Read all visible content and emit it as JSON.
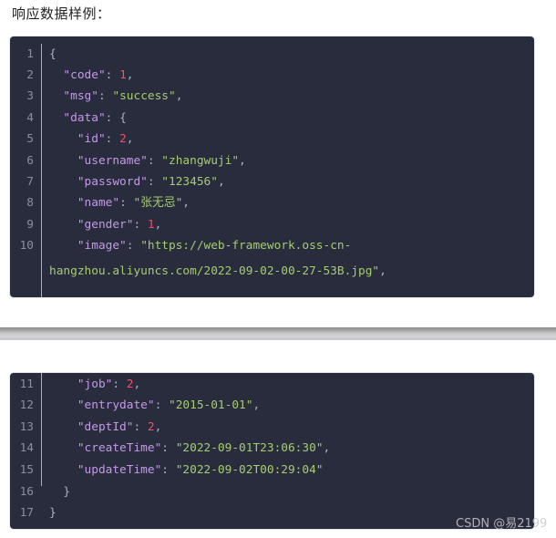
{
  "heading": "响应数据样例：",
  "watermark": "CSDN @易2199",
  "colors": {
    "background": "#282c3c",
    "key": "#c39ae8",
    "string": "#a7cc71",
    "number": "#f0506e",
    "punctuation": "#abb2bf",
    "line_number": "#8a8f9c"
  },
  "blocks": [
    {
      "lines": [
        {
          "num": "1",
          "tokens": [
            {
              "t": "p",
              "v": "{"
            }
          ]
        },
        {
          "num": "2",
          "tokens": [
            {
              "t": "p",
              "v": "  "
            },
            {
              "t": "k",
              "v": "\"code\""
            },
            {
              "t": "p",
              "v": ": "
            },
            {
              "t": "n",
              "v": "1"
            },
            {
              "t": "p",
              "v": ","
            }
          ]
        },
        {
          "num": "3",
          "tokens": [
            {
              "t": "p",
              "v": "  "
            },
            {
              "t": "k",
              "v": "\"msg\""
            },
            {
              "t": "p",
              "v": ": "
            },
            {
              "t": "s",
              "v": "\"success\""
            },
            {
              "t": "p",
              "v": ","
            }
          ]
        },
        {
          "num": "4",
          "tokens": [
            {
              "t": "p",
              "v": "  "
            },
            {
              "t": "k",
              "v": "\"data\""
            },
            {
              "t": "p",
              "v": ": {"
            }
          ]
        },
        {
          "num": "5",
          "tokens": [
            {
              "t": "p",
              "v": "    "
            },
            {
              "t": "k",
              "v": "\"id\""
            },
            {
              "t": "p",
              "v": ": "
            },
            {
              "t": "n",
              "v": "2"
            },
            {
              "t": "p",
              "v": ","
            }
          ]
        },
        {
          "num": "6",
          "tokens": [
            {
              "t": "p",
              "v": "    "
            },
            {
              "t": "k",
              "v": "\"username\""
            },
            {
              "t": "p",
              "v": ": "
            },
            {
              "t": "s",
              "v": "\"zhangwuji\""
            },
            {
              "t": "p",
              "v": ","
            }
          ]
        },
        {
          "num": "7",
          "tokens": [
            {
              "t": "p",
              "v": "    "
            },
            {
              "t": "k",
              "v": "\"password\""
            },
            {
              "t": "p",
              "v": ": "
            },
            {
              "t": "s",
              "v": "\"123456\""
            },
            {
              "t": "p",
              "v": ","
            }
          ]
        },
        {
          "num": "8",
          "tokens": [
            {
              "t": "p",
              "v": "    "
            },
            {
              "t": "k",
              "v": "\"name\""
            },
            {
              "t": "p",
              "v": ": "
            },
            {
              "t": "s",
              "v": "\"张无忌\""
            },
            {
              "t": "p",
              "v": ","
            }
          ]
        },
        {
          "num": "9",
          "tokens": [
            {
              "t": "p",
              "v": "    "
            },
            {
              "t": "k",
              "v": "\"gender\""
            },
            {
              "t": "p",
              "v": ": "
            },
            {
              "t": "n",
              "v": "1"
            },
            {
              "t": "p",
              "v": ","
            }
          ]
        },
        {
          "num": "10",
          "tokens": [
            {
              "t": "p",
              "v": "    "
            },
            {
              "t": "k",
              "v": "\"image\""
            },
            {
              "t": "p",
              "v": ": "
            },
            {
              "t": "s",
              "v": "\"https://web-framework.oss-cn-"
            }
          ]
        },
        {
          "num": "",
          "tokens": [
            {
              "t": "s",
              "v": "hangzhou.aliyuncs.com/2022-09-02-00-27-53B.jpg\""
            },
            {
              "t": "p",
              "v": ","
            }
          ]
        }
      ]
    },
    {
      "lines": [
        {
          "num": "11",
          "tokens": [
            {
              "t": "p",
              "v": "    "
            },
            {
              "t": "k",
              "v": "\"job\""
            },
            {
              "t": "p",
              "v": ": "
            },
            {
              "t": "n",
              "v": "2"
            },
            {
              "t": "p",
              "v": ","
            }
          ]
        },
        {
          "num": "12",
          "tokens": [
            {
              "t": "p",
              "v": "    "
            },
            {
              "t": "k",
              "v": "\"entrydate\""
            },
            {
              "t": "p",
              "v": ": "
            },
            {
              "t": "s",
              "v": "\"2015-01-01\""
            },
            {
              "t": "p",
              "v": ","
            }
          ]
        },
        {
          "num": "13",
          "tokens": [
            {
              "t": "p",
              "v": "    "
            },
            {
              "t": "k",
              "v": "\"deptId\""
            },
            {
              "t": "p",
              "v": ": "
            },
            {
              "t": "n",
              "v": "2"
            },
            {
              "t": "p",
              "v": ","
            }
          ]
        },
        {
          "num": "14",
          "tokens": [
            {
              "t": "p",
              "v": "    "
            },
            {
              "t": "k",
              "v": "\"createTime\""
            },
            {
              "t": "p",
              "v": ": "
            },
            {
              "t": "s",
              "v": "\"2022-09-01T23:06:30\""
            },
            {
              "t": "p",
              "v": ","
            }
          ]
        },
        {
          "num": "15",
          "tokens": [
            {
              "t": "p",
              "v": "    "
            },
            {
              "t": "k",
              "v": "\"updateTime\""
            },
            {
              "t": "p",
              "v": ": "
            },
            {
              "t": "s",
              "v": "\"2022-09-02T00:29:04\""
            }
          ]
        },
        {
          "num": "16",
          "tokens": [
            {
              "t": "p",
              "v": "  }"
            }
          ]
        },
        {
          "num": "17",
          "tokens": [
            {
              "t": "p",
              "v": "}"
            }
          ]
        }
      ]
    }
  ]
}
